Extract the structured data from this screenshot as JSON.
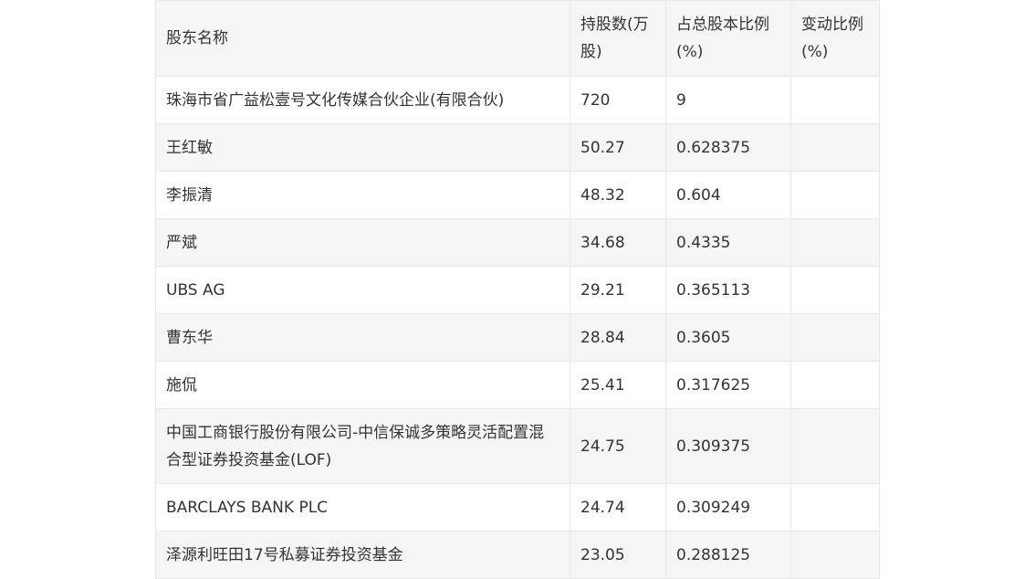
{
  "table": {
    "headers": [
      "股东名称",
      "持股数(万股)",
      "占总股本比例(%)",
      "变动比例(%)"
    ],
    "rows": [
      {
        "name": "珠海市省广益松壹号文化传媒合伙企业(有限合伙)",
        "shares": "720",
        "ratio": "9",
        "change": ""
      },
      {
        "name": "王红敏",
        "shares": "50.27",
        "ratio": "0.628375",
        "change": ""
      },
      {
        "name": "李振清",
        "shares": "48.32",
        "ratio": "0.604",
        "change": ""
      },
      {
        "name": "严斌",
        "shares": "34.68",
        "ratio": "0.4335",
        "change": ""
      },
      {
        "name": "UBS AG",
        "shares": "29.21",
        "ratio": "0.365113",
        "change": ""
      },
      {
        "name": "曹东华",
        "shares": "28.84",
        "ratio": "0.3605",
        "change": ""
      },
      {
        "name": "施侃",
        "shares": "25.41",
        "ratio": "0.317625",
        "change": ""
      },
      {
        "name": "中国工商银行股份有限公司-中信保诚多策略灵活配置混合型证券投资基金(LOF)",
        "shares": "24.75",
        "ratio": "0.309375",
        "change": ""
      },
      {
        "name": "BARCLAYS BANK PLC",
        "shares": "24.74",
        "ratio": "0.309249",
        "change": ""
      },
      {
        "name": "泽源利旺田17号私募证券投资基金",
        "shares": "23.05",
        "ratio": "0.288125",
        "change": ""
      }
    ]
  }
}
